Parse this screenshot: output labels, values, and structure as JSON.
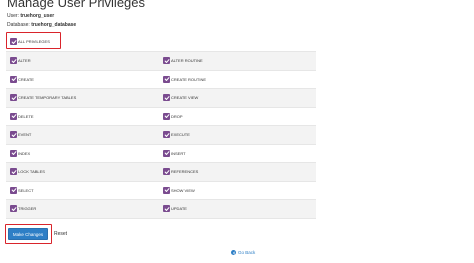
{
  "page": {
    "title": "Manage User Privileges",
    "user_label": "User:",
    "user_value": "truehorg_user",
    "database_label": "Database:",
    "database_value": "truehorg_database"
  },
  "all_privileges": {
    "label": "ALL PRIVILEGES",
    "checked": true
  },
  "privileges": [
    {
      "left": "ALTER",
      "right": "ALTER ROUTINE"
    },
    {
      "left": "CREATE",
      "right": "CREATE ROUTINE"
    },
    {
      "left": "CREATE TEMPORARY TABLES",
      "right": "CREATE VIEW"
    },
    {
      "left": "DELETE",
      "right": "DROP"
    },
    {
      "left": "EVENT",
      "right": "EXECUTE"
    },
    {
      "left": "INDEX",
      "right": "INSERT"
    },
    {
      "left": "LOCK TABLES",
      "right": "REFERENCES"
    },
    {
      "left": "SELECT",
      "right": "SHOW VIEW"
    },
    {
      "left": "TRIGGER",
      "right": "UPDATE"
    }
  ],
  "actions": {
    "make_changes_label": "Make Changes",
    "reset_label": "Reset",
    "go_back_label": "Go Back"
  },
  "colors": {
    "checkbox": "#7a4b8f",
    "primary_button": "#2e7fc6",
    "highlight_outline": "#d9242b"
  },
  "icons": {
    "checkbox_checked": "check-icon",
    "go_back": "arrow-left-circle-icon"
  }
}
